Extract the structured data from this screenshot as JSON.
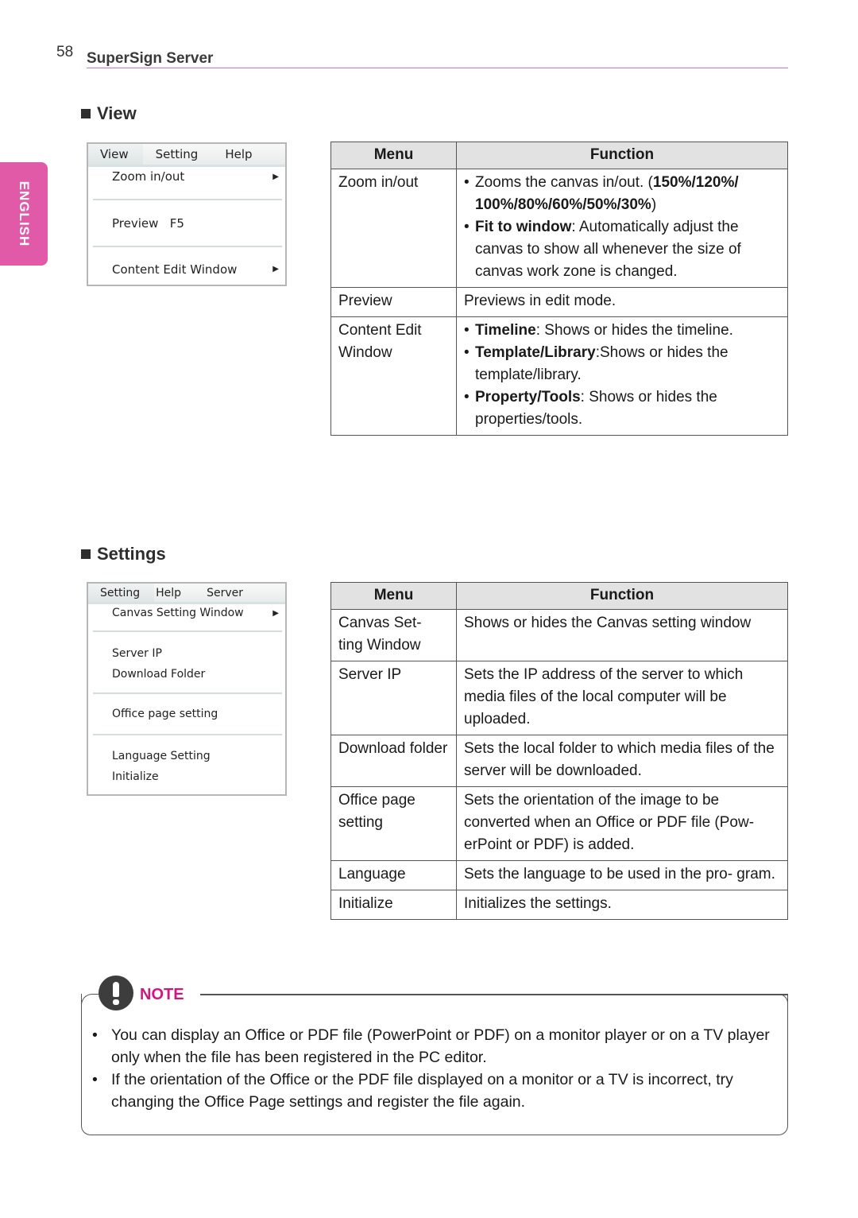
{
  "page": {
    "number": "58",
    "running_header": "SuperSign Server",
    "language_tab": "ENGLISH",
    "accent_color": "#e05aa8"
  },
  "view_section": {
    "heading": "View",
    "menu_screenshot": {
      "menubar": [
        "View",
        "Setting",
        "Help"
      ],
      "items": [
        {
          "label": "Zoom in/out",
          "submenu": true
        },
        {
          "label": "Preview   F5",
          "submenu": false
        },
        {
          "label": "Content Edit Window",
          "submenu": true
        }
      ]
    },
    "table": {
      "headers": [
        "Menu",
        "Function"
      ],
      "rows": [
        {
          "menu": "Zoom in/out",
          "bullets": [
            {
              "pre": "Zooms the canvas in/out. (",
              "bold": "150%/120%/ 100%/80%/60%/50%/30%",
              "post": ")"
            },
            {
              "pre": "",
              "bold": "Fit to window",
              "post": ": Automatically adjust the canvas to show all whenever the size of canvas work zone is changed."
            }
          ]
        },
        {
          "menu": "Preview",
          "text": "Previews in edit mode."
        },
        {
          "menu": "Content Edit Window",
          "bullets": [
            {
              "pre": "",
              "bold": "Timeline",
              "post": ": Shows or hides the timeline."
            },
            {
              "pre": "",
              "bold": "Template/Library",
              "post": ":Shows or hides the template/library."
            },
            {
              "pre": "",
              "bold": "Property/Tools",
              "post": ": Shows or hides the properties/tools."
            }
          ]
        }
      ]
    }
  },
  "settings_section": {
    "heading": "Settings",
    "menu_screenshot": {
      "menubar": [
        "Setting",
        "Help",
        "Server"
      ],
      "groups": [
        [
          {
            "label": "Canvas Setting Window",
            "submenu": true
          }
        ],
        [
          {
            "label": "Server IP"
          },
          {
            "label": "Download Folder"
          }
        ],
        [
          {
            "label": "Office page setting"
          }
        ],
        [
          {
            "label": "Language Setting"
          },
          {
            "label": "Initialize"
          }
        ]
      ]
    },
    "table": {
      "headers": [
        "Menu",
        "Function"
      ],
      "rows": [
        {
          "menu": "Canvas Set- ting Window",
          "text": "Shows or hides the Canvas setting window"
        },
        {
          "menu": "Server IP",
          "text": "Sets the IP address of the server to which media files of the local computer will be uploaded."
        },
        {
          "menu": "Download folder",
          "text": "Sets the local folder to which media files of the server will be downloaded."
        },
        {
          "menu": "Office page setting",
          "text": "Sets the orientation of the image to be converted when an Office or PDF file (Pow- erPoint or PDF) is added."
        },
        {
          "menu": "Language",
          "text": "Sets the language to be used in the pro- gram."
        },
        {
          "menu": "Initialize",
          "text": "Initializes the settings."
        }
      ]
    }
  },
  "note": {
    "label": "NOTE",
    "label_color": "#d4157f",
    "items": [
      "You can display an Office or PDF file (PowerPoint or PDF) on a monitor player or on a TV player only when the file has been registered in the PC editor.",
      "If the orientation of the Office or the PDF file displayed on a monitor or a TV is incorrect, try changing the Office Page settings and register the file again."
    ]
  }
}
